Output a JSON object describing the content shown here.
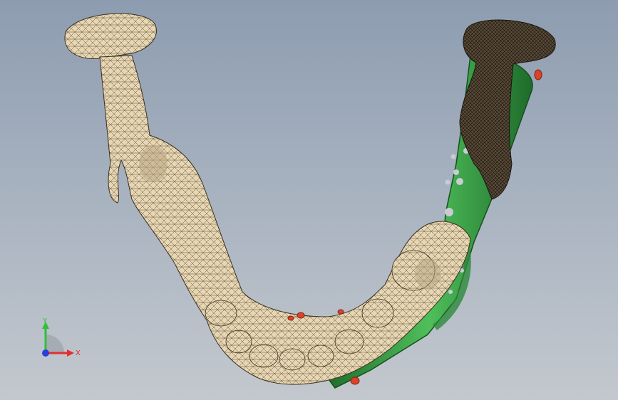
{
  "viewport": {
    "background_top": "#8d9cb0",
    "background_bottom": "#c3c8ce"
  },
  "model": {
    "bone_color": "#e8d6b2",
    "mesh_color": "#2a2418",
    "plate_color": "#3fa34a",
    "plate_dark": "#1e6b2a",
    "screw_color": "#d8432a"
  },
  "triad": {
    "x_label": "X",
    "y_label": "Y",
    "x_color": "#e03030",
    "y_color": "#2fbf3a",
    "z_color": "#2a3fd8"
  }
}
